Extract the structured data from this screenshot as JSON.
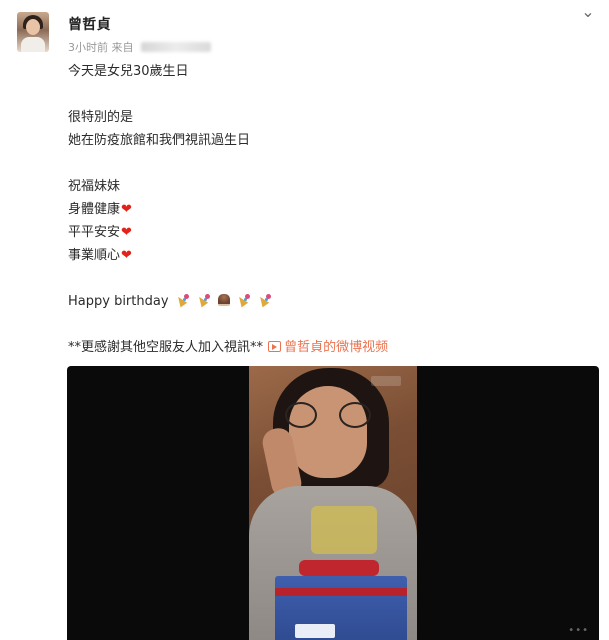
{
  "post": {
    "username": "曾哲貞",
    "time": "3小时前",
    "source_prefix": "来自",
    "more_icon": "chevron-down-icon",
    "lines": [
      "今天是女兒30歲生日",
      "很特別的是",
      "她在防疫旅館和我們視訊過生日",
      "祝福妹妹",
      "身體健康",
      "平平安安",
      "事業順心",
      "Happy birthday"
    ],
    "heart": "❤",
    "thanks_text": "**更感謝其他空服友人加入視訊**",
    "video_link": "曾哲貞的微博视频"
  },
  "colors": {
    "link": "#eb7350",
    "heart": "#e2231a"
  }
}
